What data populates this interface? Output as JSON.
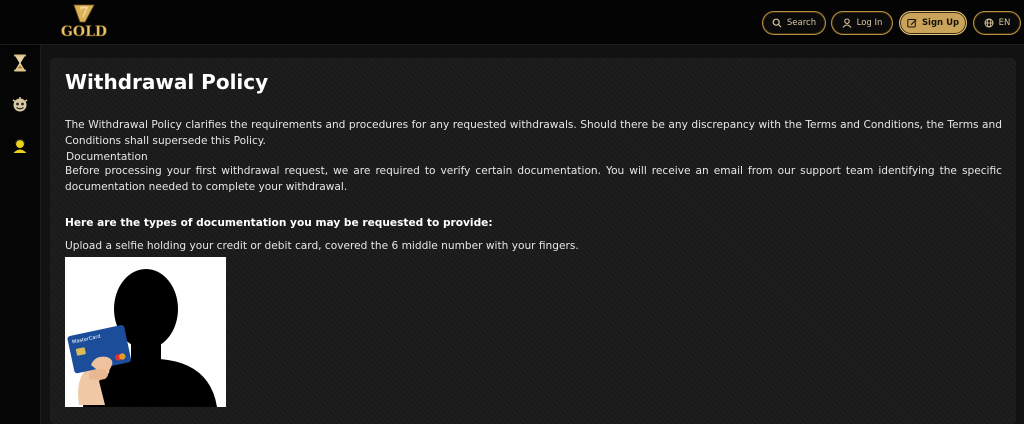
{
  "header": {
    "logo_number": "7",
    "logo_text": "GOLD",
    "search_label": "Search",
    "login_label": "Log In",
    "signup_label": "Sign Up",
    "language_label": "EN",
    "colors": {
      "accent": "#c9a45a",
      "border": "#b8923e",
      "background": "#040404"
    }
  },
  "sidebar": {
    "items": [
      {
        "icon": "menu-icon"
      },
      {
        "icon": "hourglass-icon"
      },
      {
        "icon": "gamepad-icon"
      },
      {
        "icon": "user-support-icon"
      }
    ]
  },
  "main": {
    "title": "Withdrawal Policy",
    "intro": "The Withdrawal Policy clarifies the requirements and procedures for any requested withdrawals. Should there be any discrepancy with the Terms and Conditions, the Terms and Conditions shall supersede this Policy.",
    "documentation_label": "Documentation",
    "documentation_text": "Before processing your first withdrawal request, we are required to verify certain documentation. You will receive an email from our support team identifying the specific documentation needed to complete your withdrawal.",
    "types_heading": "Here are the types of documentation you may be requested to provide:",
    "selfie_instruction": "Upload a selfie holding your credit or debit card, covered the 6 middle number with your fingers.",
    "card_brand": "MasterCard"
  }
}
